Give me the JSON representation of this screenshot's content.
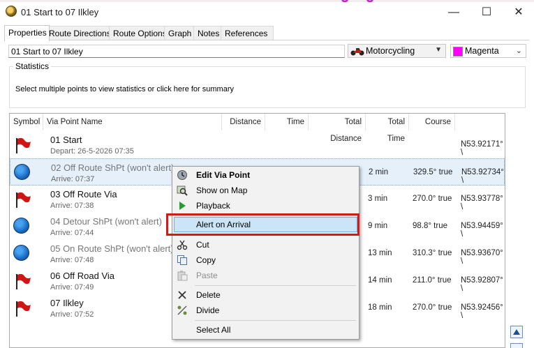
{
  "window": {
    "title": "01 Start to 07 Ilkley",
    "minimize": "—",
    "maximize": "☐",
    "close": "✕"
  },
  "tabs": [
    "Properties",
    "Route Directions",
    "Route Options",
    "Graph",
    "Notes",
    "References"
  ],
  "route": {
    "name": "01 Start to 07 Ilkley",
    "profile": "Motorcycling",
    "color_name": "Magenta",
    "color_hex": "#ff00ff"
  },
  "statistics": {
    "title": "Statistics",
    "message": "Select multiple points to view statistics or click here for summary"
  },
  "table": {
    "columns": [
      "Symbol",
      "Via Point Name",
      "Distance",
      "Time",
      "Total Distance",
      "Total Time",
      "Course"
    ],
    "rows": [
      {
        "symbol": "flag-icon",
        "name": "01 Start",
        "sub": "Depart: 26-5-2026 07:35",
        "total_time": "",
        "course": "",
        "coord": "N53.92171° \\"
      },
      {
        "symbol": "shaping-point-icon",
        "name": "02 Off Route ShPt (won't alert)",
        "sub": "Arrive: 07:37",
        "total_time": "2 min",
        "course": "329.5° true",
        "coord": "N53.92734° \\"
      },
      {
        "symbol": "flag-icon",
        "name": "03 Off Route Via",
        "sub": "Arrive: 07:38",
        "total_time": "3 min",
        "course": "270.0° true",
        "coord": "N53.93778° \\"
      },
      {
        "symbol": "shaping-point-icon",
        "name": "04 Detour ShPt (won't alert)",
        "sub": "Arrive: 07:44",
        "total_time": "9 min",
        "course": "98.8° true",
        "coord": "N53.94459° \\"
      },
      {
        "symbol": "shaping-point-icon",
        "name": "05 On Route ShPt (won't alert)",
        "sub": "Arrive: 07:48",
        "total_time": "13 min",
        "course": "310.3° true",
        "coord": "N53.93670° \\"
      },
      {
        "symbol": "flag-icon",
        "name": "06 Off Road Via",
        "sub": "Arrive: 07:49",
        "total_time": "14 min",
        "course": "211.0° true",
        "coord": "N53.92807° \\"
      },
      {
        "symbol": "flag-icon",
        "name": "07 Ilkley",
        "sub": "Arrive: 07:52",
        "total_time": "18 min",
        "course": "270.0° true",
        "coord": "N53.92456° \\"
      }
    ]
  },
  "context_menu": {
    "items": [
      {
        "label": "Edit Via Point",
        "icon": "edit-via-icon",
        "bold": true,
        "disabled": false
      },
      {
        "label": "Show on Map",
        "icon": "show-on-map-icon",
        "bold": false,
        "disabled": false
      },
      {
        "label": "Playback",
        "icon": "play-icon",
        "bold": false,
        "disabled": false
      },
      {
        "label": "Alert on Arrival",
        "icon": "",
        "bold": false,
        "disabled": false,
        "highlighted": true
      },
      {
        "label": "Cut",
        "icon": "scissors-icon",
        "bold": false,
        "disabled": false
      },
      {
        "label": "Copy",
        "icon": "copy-icon",
        "bold": false,
        "disabled": false
      },
      {
        "label": "Paste",
        "icon": "paste-icon",
        "bold": false,
        "disabled": true
      },
      {
        "label": "Delete",
        "icon": "delete-icon",
        "bold": false,
        "disabled": false
      },
      {
        "label": "Divide",
        "icon": "divide-icon",
        "bold": false,
        "disabled": false
      },
      {
        "label": "Select All",
        "icon": "",
        "bold": false,
        "disabled": false
      }
    ]
  },
  "colors": {
    "selection": "#e5f0fb",
    "menu_highlight": "#cce4f7",
    "annotation_red": "#d11a1a"
  }
}
